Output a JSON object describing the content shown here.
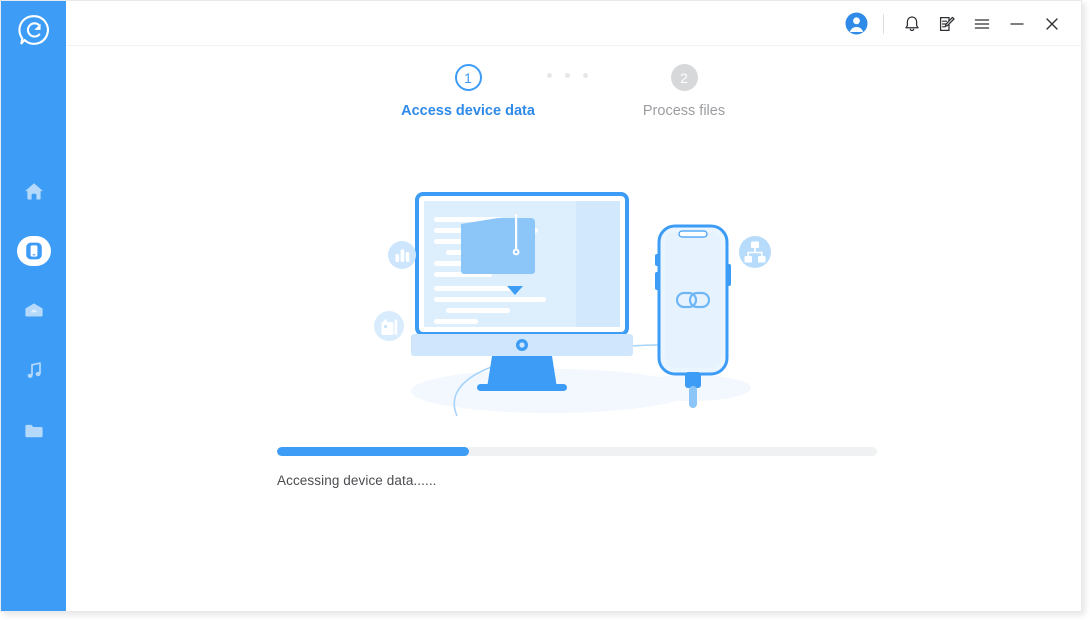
{
  "window": {
    "app_logo_icon": "circle-c-logo-icon",
    "title_controls": [
      {
        "name": "avatar",
        "icon": "user-avatar-icon",
        "label": "Account"
      },
      {
        "name": "notifications",
        "icon": "bell-icon",
        "label": "Notifications"
      },
      {
        "name": "feedback",
        "icon": "note-edit-icon",
        "label": "Feedback"
      },
      {
        "name": "menu",
        "icon": "hamburger-menu-icon",
        "label": "Menu"
      },
      {
        "name": "minimize",
        "icon": "minimize-icon",
        "label": "Minimize"
      },
      {
        "name": "close",
        "icon": "close-icon",
        "label": "Close"
      }
    ]
  },
  "sidebar": {
    "background_color": "#3c9cf6",
    "items": [
      {
        "name": "home",
        "icon": "home-icon",
        "label": "Home",
        "active": false
      },
      {
        "name": "device",
        "icon": "phone-device-icon",
        "label": "Device",
        "active": true
      },
      {
        "name": "cloud",
        "icon": "cloud-icon",
        "label": "Cloud",
        "active": false
      },
      {
        "name": "music",
        "icon": "music-note-icon",
        "label": "Music",
        "active": false
      },
      {
        "name": "files",
        "icon": "folder-icon",
        "label": "Files",
        "active": false
      }
    ]
  },
  "stepper": {
    "steps": [
      {
        "number": "1",
        "label": "Access device data",
        "state": "active"
      },
      {
        "number": "2",
        "label": "Process files",
        "state": "inactive"
      }
    ],
    "separator_dots": 3,
    "active_color": "#2f8ae8",
    "inactive_color": "#9b9da1"
  },
  "illustration": {
    "name": "device-connected-to-computer-illustration",
    "elements": [
      {
        "name": "monitor",
        "icon": "desktop-monitor-icon"
      },
      {
        "name": "folder-zip",
        "icon": "zipped-folder-icon"
      },
      {
        "name": "download-arrow",
        "icon": "download-arrow-icon"
      },
      {
        "name": "phone",
        "icon": "smartphone-icon"
      },
      {
        "name": "phone-screen-link",
        "icon": "link-chain-icon"
      },
      {
        "name": "usb-cable",
        "icon": "usb-cable-icon"
      },
      {
        "name": "badge-chart",
        "icon": "bar-chart-icon"
      },
      {
        "name": "badge-document",
        "icon": "document-chart-icon"
      },
      {
        "name": "badge-network",
        "icon": "sitemap-network-icon"
      }
    ],
    "accent_color": "#3c9cf6"
  },
  "progress": {
    "percent": 32,
    "percent_text": "32%",
    "status_text": "Accessing device data......",
    "fill_color": "#3c9cf6",
    "track_color": "#f0f1f2"
  }
}
